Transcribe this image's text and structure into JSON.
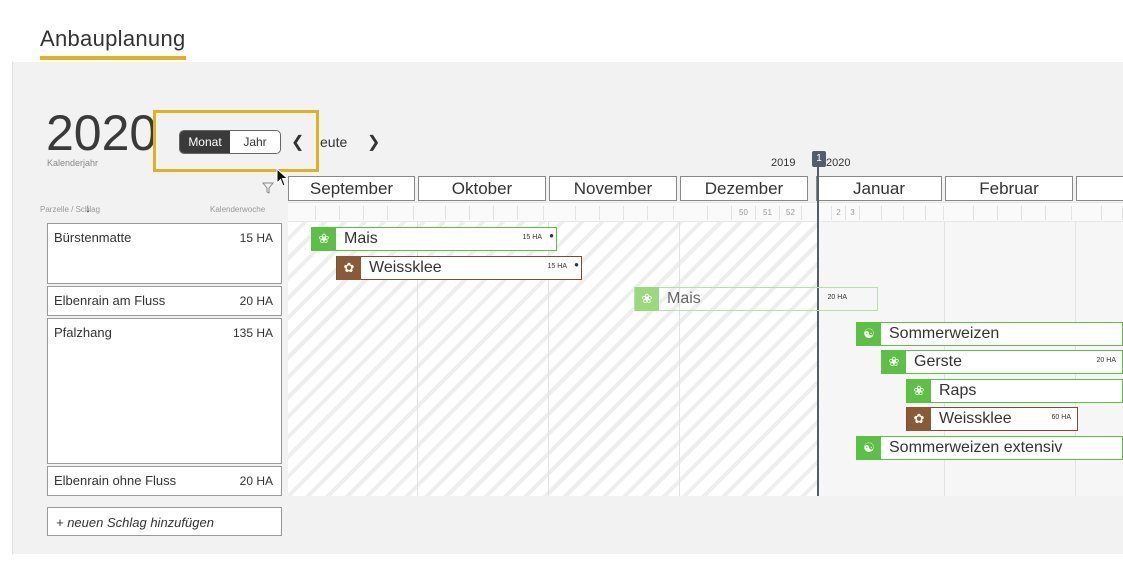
{
  "page": {
    "title": "Anbauplanung"
  },
  "calendar": {
    "year": "2020",
    "year_label": "Kalenderjahr",
    "view_toggle": {
      "month_label": "Monat",
      "year_label": "Jahr",
      "active": "Monat"
    },
    "prev_icon": "chevron-left-icon",
    "next_icon": "chevron-right-icon",
    "today_label": "Heute",
    "today_label_visible": "eute",
    "year_divider": {
      "left": "2019",
      "right": "2020",
      "week_marker": "1"
    },
    "months": [
      "September",
      "Oktober",
      "November",
      "Dezember",
      "Januar",
      "Februar"
    ],
    "weeks_visible": [
      "50",
      "51",
      "52",
      "2",
      "3"
    ]
  },
  "table": {
    "col_left": "Parzelle / Schlag",
    "col_right": "Kalenderwoche",
    "sort_icon": "sort-down-icon",
    "filter_icon": "filter-icon",
    "plots": [
      {
        "name": "Bürstenmatte",
        "size": "15 HA",
        "crops": [
          {
            "name": "Mais",
            "ha": "15 HA",
            "color": "#5bc043",
            "icon": "leaf-icon",
            "locked": true
          },
          {
            "name": "Weissklee",
            "ha": "15 HA",
            "color": "#8a5a35",
            "icon": "clover-icon",
            "locked": true
          }
        ]
      },
      {
        "name": "Elbenrain am Fluss",
        "size": "20 HA",
        "crops": [
          {
            "name": "Mais",
            "ha": "20 HA",
            "color": "#9bd97e",
            "icon": "leaf-icon",
            "locked": false
          }
        ]
      },
      {
        "name": "Pfalzhang",
        "size": "135 HA",
        "crops": [
          {
            "name": "Sommerweizen",
            "ha": "",
            "color": "#5bc043",
            "icon": "wheat-icon",
            "locked": false
          },
          {
            "name": "Gerste",
            "ha": "20 HA",
            "color": "#5bc043",
            "icon": "leaf-icon",
            "locked": false
          },
          {
            "name": "Raps",
            "ha": "",
            "color": "#5bc043",
            "icon": "leaf-icon",
            "locked": false
          },
          {
            "name": "Weissklee",
            "ha": "60 HA",
            "color": "#8a5a35",
            "icon": "clover-icon",
            "locked": false
          },
          {
            "name": "Sommerweizen extensiv",
            "ha": "",
            "color": "#5bc043",
            "icon": "wheat-icon",
            "locked": false
          }
        ]
      },
      {
        "name": "Elbenrain ohne Fluss",
        "size": "20 HA",
        "crops": []
      }
    ],
    "add_plot_label": "+ neuen Schlag hinzufügen"
  },
  "colors": {
    "accent": "#e0b21c",
    "crop_green": "#5bc043",
    "crop_brown": "#8a5a35",
    "today_line": "#565d6a"
  }
}
